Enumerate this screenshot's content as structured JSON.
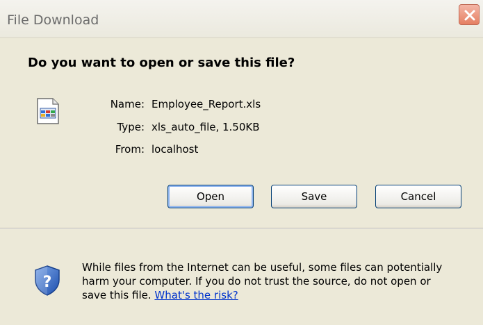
{
  "window": {
    "title": "File Download"
  },
  "dialog": {
    "question": "Do you want to open or save this file?",
    "file_icon": "spreadsheet-file-icon",
    "info": {
      "name_label": "Name:",
      "name_value": "Employee_Report.xls",
      "type_label": "Type:",
      "type_value": "xls_auto_file, 1.50KB",
      "from_label": "From:",
      "from_value": "localhost"
    },
    "buttons": {
      "open": "Open",
      "save": "Save",
      "cancel": "Cancel"
    },
    "warning": {
      "icon": "shield-question-icon",
      "line1": "While files from the Internet can be useful, some files can potentially",
      "line2": "harm your computer. If you do not trust the source, do not open or",
      "line3": "save this file.",
      "link": "What's the risk?"
    }
  },
  "colors": {
    "dialog_bg": "#ECE9D8",
    "button_border": "#003C74",
    "link": "#0033CC",
    "close_button": "#E57F62"
  }
}
